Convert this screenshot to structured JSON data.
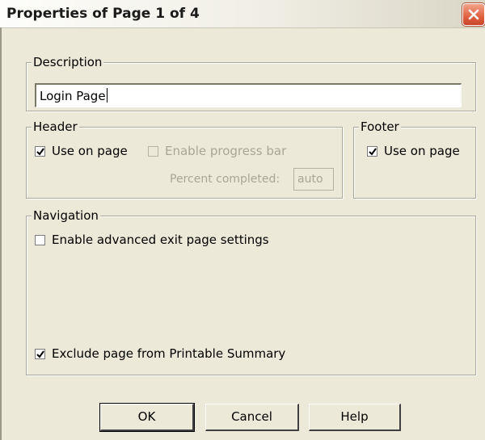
{
  "title": "Properties of Page 1 of 4",
  "description": {
    "legend": "Description",
    "value": "Login Page"
  },
  "header": {
    "legend": "Header",
    "use_on_page": {
      "label": "Use on page",
      "checked": true
    },
    "enable_progress_bar": {
      "label": "Enable progress bar",
      "checked": false,
      "disabled": true
    },
    "percent_label": "Percent completed:",
    "percent_value": "auto"
  },
  "footer": {
    "legend": "Footer",
    "use_on_page": {
      "label": "Use on page",
      "checked": true
    }
  },
  "navigation": {
    "legend": "Navigation",
    "advanced_exit": {
      "label": "Enable advanced exit page settings",
      "checked": false
    },
    "exclude_printable": {
      "label": "Exclude page from Printable Summary",
      "checked": true
    }
  },
  "buttons": {
    "ok": "OK",
    "cancel": "Cancel",
    "help": "Help"
  },
  "colors": {
    "dialog_bg": "#ece9d8",
    "close_button": "#df6240",
    "disabled_text": "#a8a696"
  }
}
